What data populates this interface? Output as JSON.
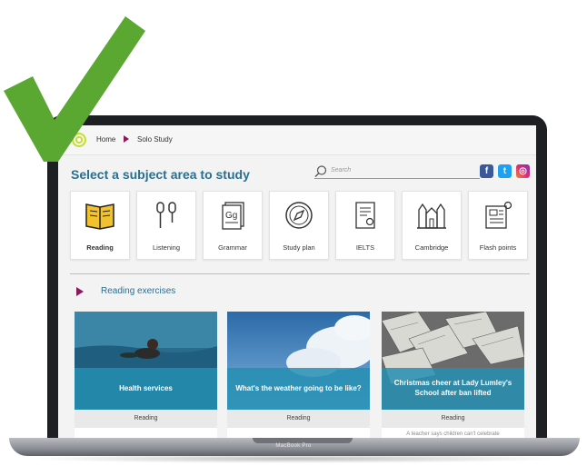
{
  "breadcrumb": {
    "home": "Home",
    "current": "Solo Study"
  },
  "heading": "Select a subject area to study",
  "search": {
    "placeholder": "Search"
  },
  "social": {
    "facebook": "f",
    "twitter": "t",
    "instagram": "◎"
  },
  "tiles": [
    {
      "label": "Reading",
      "icon": "book-icon",
      "active": true
    },
    {
      "label": "Listening",
      "icon": "earphones-icon",
      "active": false
    },
    {
      "label": "Grammar",
      "icon": "grammar-icon",
      "active": false
    },
    {
      "label": "Study plan",
      "icon": "compass-icon",
      "active": false
    },
    {
      "label": "IELTS",
      "icon": "certificate-icon",
      "active": false
    },
    {
      "label": "Cambridge",
      "icon": "building-icon",
      "active": false
    },
    {
      "label": "Flash points",
      "icon": "news-icon",
      "active": false
    }
  ],
  "section_title": "Reading exercises",
  "cards": [
    {
      "title": "Health services",
      "tag": "Reading",
      "subtitle": ""
    },
    {
      "title": "What's the weather going to be like?",
      "tag": "Reading",
      "subtitle": ""
    },
    {
      "title": "Christmas cheer at Lady Lumley's School after ban lifted",
      "tag": "Reading",
      "subtitle": "A teacher says children can't celebrate"
    }
  ],
  "laptop_label": "MacBook Pro",
  "colors": {
    "accent": "#2a6f8f",
    "arrow": "#8b1a5a",
    "check": "#5aa832",
    "overlay": "#248eb2"
  }
}
